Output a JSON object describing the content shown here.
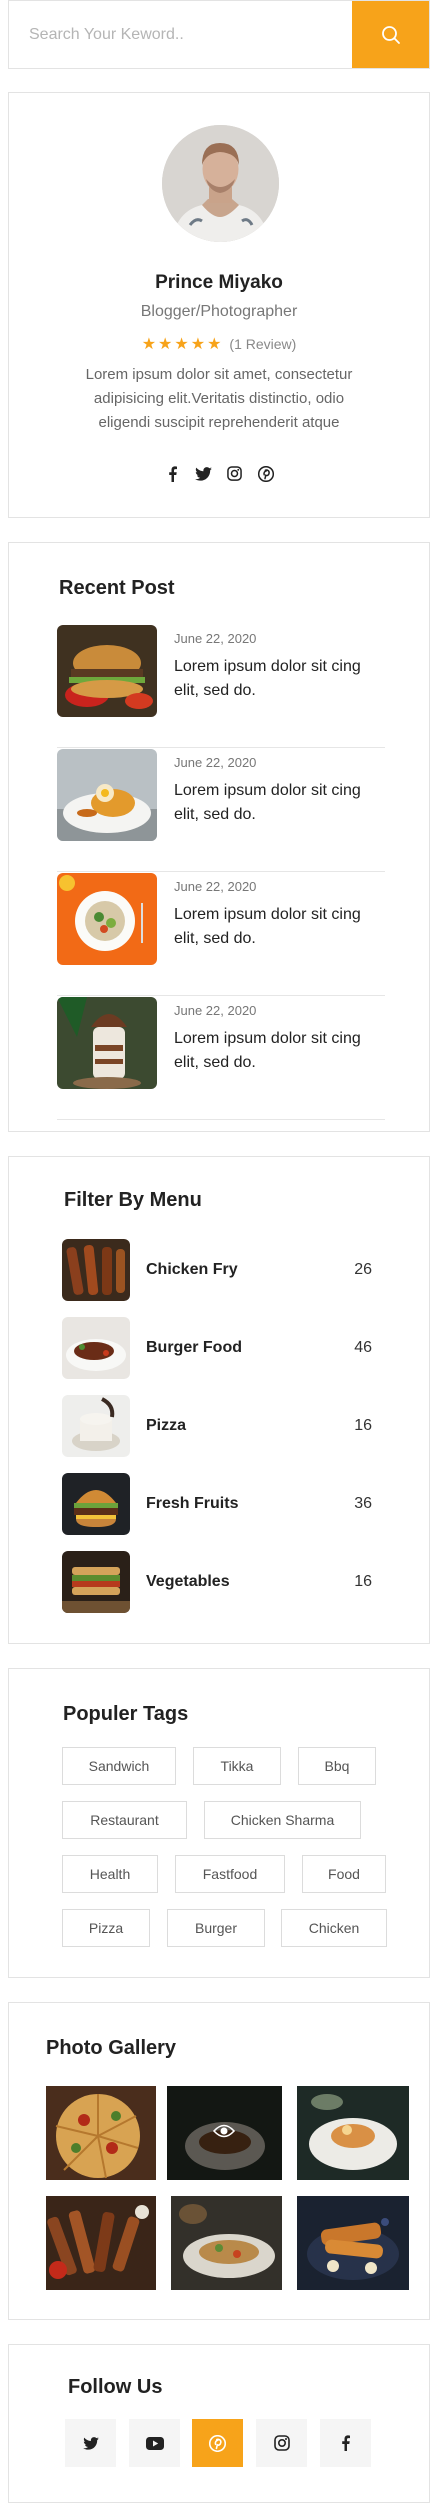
{
  "search": {
    "placeholder": "Search Your Keword..",
    "icon": "search-icon"
  },
  "profile": {
    "name": "Prince Miyako",
    "role": "Blogger/Photographer",
    "stars": "★★★★★",
    "reviews": "(1 Review)",
    "bio": "Lorem ipsum dolor sit amet, consectetur adipisicing elit.Veritatis distinctio, odio eligendi suscipit reprehenderit atque",
    "socials": [
      "facebook-icon",
      "twitter-icon",
      "instagram-icon",
      "pinterest-icon"
    ]
  },
  "recent": {
    "title": "Recent Post",
    "posts": [
      {
        "date": "June 22, 2020",
        "text": "Lorem ipsum dolor sit cing elit, sed do."
      },
      {
        "date": "June 22, 2020",
        "text": "Lorem ipsum dolor sit cing elit, sed do."
      },
      {
        "date": "June 22, 2020",
        "text": "Lorem ipsum dolor sit cing elit, sed do."
      },
      {
        "date": "June 22, 2020",
        "text": "Lorem ipsum dolor sit cing elit, sed do."
      }
    ]
  },
  "menu": {
    "title": "Filter By Menu",
    "items": [
      {
        "name": "Chicken Fry",
        "count": "26"
      },
      {
        "name": "Burger Food",
        "count": "46"
      },
      {
        "name": "Pizza",
        "count": "16"
      },
      {
        "name": "Fresh Fruits",
        "count": "36"
      },
      {
        "name": "Vegetables",
        "count": "16"
      }
    ]
  },
  "tags": {
    "title": "Populer Tags",
    "items": [
      "Sandwich",
      "Tikka",
      "Bbq",
      "Restaurant",
      "Chicken Sharma",
      "Health",
      "Fastfood",
      "Food",
      "Pizza",
      "Burger",
      "Chicken"
    ]
  },
  "gallery": {
    "title": "Photo Gallery",
    "overlay_icon": "eye-icon"
  },
  "follow": {
    "title": "Follow Us",
    "icons": [
      "twitter-icon",
      "youtube-icon",
      "pinterest-icon",
      "instagram-icon",
      "facebook-icon"
    ],
    "active_color": "#f7a31a"
  },
  "colors": {
    "accent": "#f7a31a",
    "border": "#e3e3e3"
  }
}
